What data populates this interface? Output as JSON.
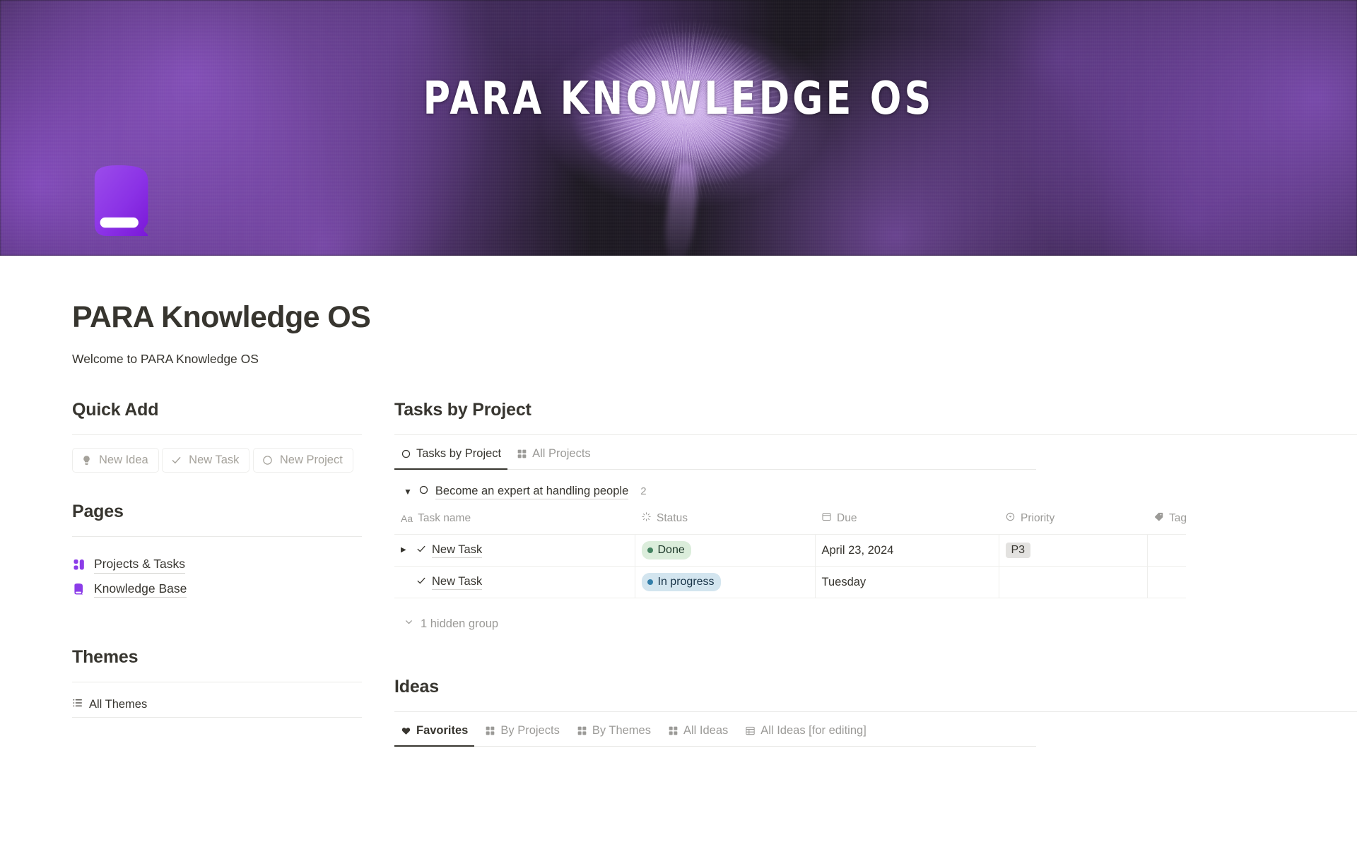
{
  "cover": {
    "banner_text": "PARA KNOWLEDGE OS"
  },
  "page": {
    "icon": "book-icon",
    "title": "PARA Knowledge OS",
    "subtitle": "Welcome to PARA Knowledge OS"
  },
  "quick_add": {
    "heading": "Quick Add",
    "buttons": [
      {
        "label": "New Idea",
        "icon": "lightbulb-icon"
      },
      {
        "label": "New Task",
        "icon": "check-icon"
      },
      {
        "label": "New Project",
        "icon": "circle-icon"
      }
    ]
  },
  "pages": {
    "heading": "Pages",
    "items": [
      {
        "label": "Projects & Tasks",
        "icon": "kanban-icon"
      },
      {
        "label": "Knowledge Base",
        "icon": "book-icon"
      }
    ]
  },
  "themes": {
    "heading": "Themes",
    "tabs": [
      {
        "label": "All Themes",
        "icon": "list-view-icon",
        "active": false
      }
    ]
  },
  "tasks_by_project": {
    "heading": "Tasks by Project",
    "tabs": [
      {
        "label": "Tasks by Project",
        "icon": "circle-icon",
        "active": true
      },
      {
        "label": "All Projects",
        "icon": "gallery-icon",
        "active": false
      }
    ],
    "group": {
      "name": "Become an expert at handling people",
      "count": "2",
      "icon": "circle-icon",
      "caret": "▼"
    },
    "columns": [
      {
        "label": "Task name",
        "icon": "title-icon"
      },
      {
        "label": "Status",
        "icon": "status-icon"
      },
      {
        "label": "Due",
        "icon": "calendar-icon"
      },
      {
        "label": "Priority",
        "icon": "select-icon"
      },
      {
        "label": "Tags",
        "icon": "tag-icon"
      }
    ],
    "rows": [
      {
        "name": "New Task",
        "status": "Done",
        "status_bg": "#dbeddb",
        "status_dot": "#448361",
        "status_fg": "#1c3829",
        "due": "April 23, 2024",
        "priority": "P3",
        "tags": ""
      },
      {
        "name": "New Task",
        "status": "In progress",
        "status_bg": "#d3e5ef",
        "status_dot": "#337ea9",
        "status_fg": "#183347",
        "due": "Tuesday",
        "priority": "",
        "tags": ""
      }
    ],
    "hidden_group_label": "1 hidden group"
  },
  "ideas": {
    "heading": "Ideas",
    "tabs": [
      {
        "label": "Favorites",
        "icon": "heart-icon",
        "active": true
      },
      {
        "label": "By Projects",
        "icon": "gallery-icon",
        "active": false
      },
      {
        "label": "By Themes",
        "icon": "gallery-icon",
        "active": false
      },
      {
        "label": "All Ideas",
        "icon": "gallery-icon",
        "active": false
      },
      {
        "label": "All Ideas [for editing]",
        "icon": "table-icon",
        "active": false
      }
    ]
  },
  "colors": {
    "accent_purple": "#8b3ce8",
    "text": "#37352f",
    "muted": "#9b9a97",
    "border": "#e9e9e7"
  }
}
